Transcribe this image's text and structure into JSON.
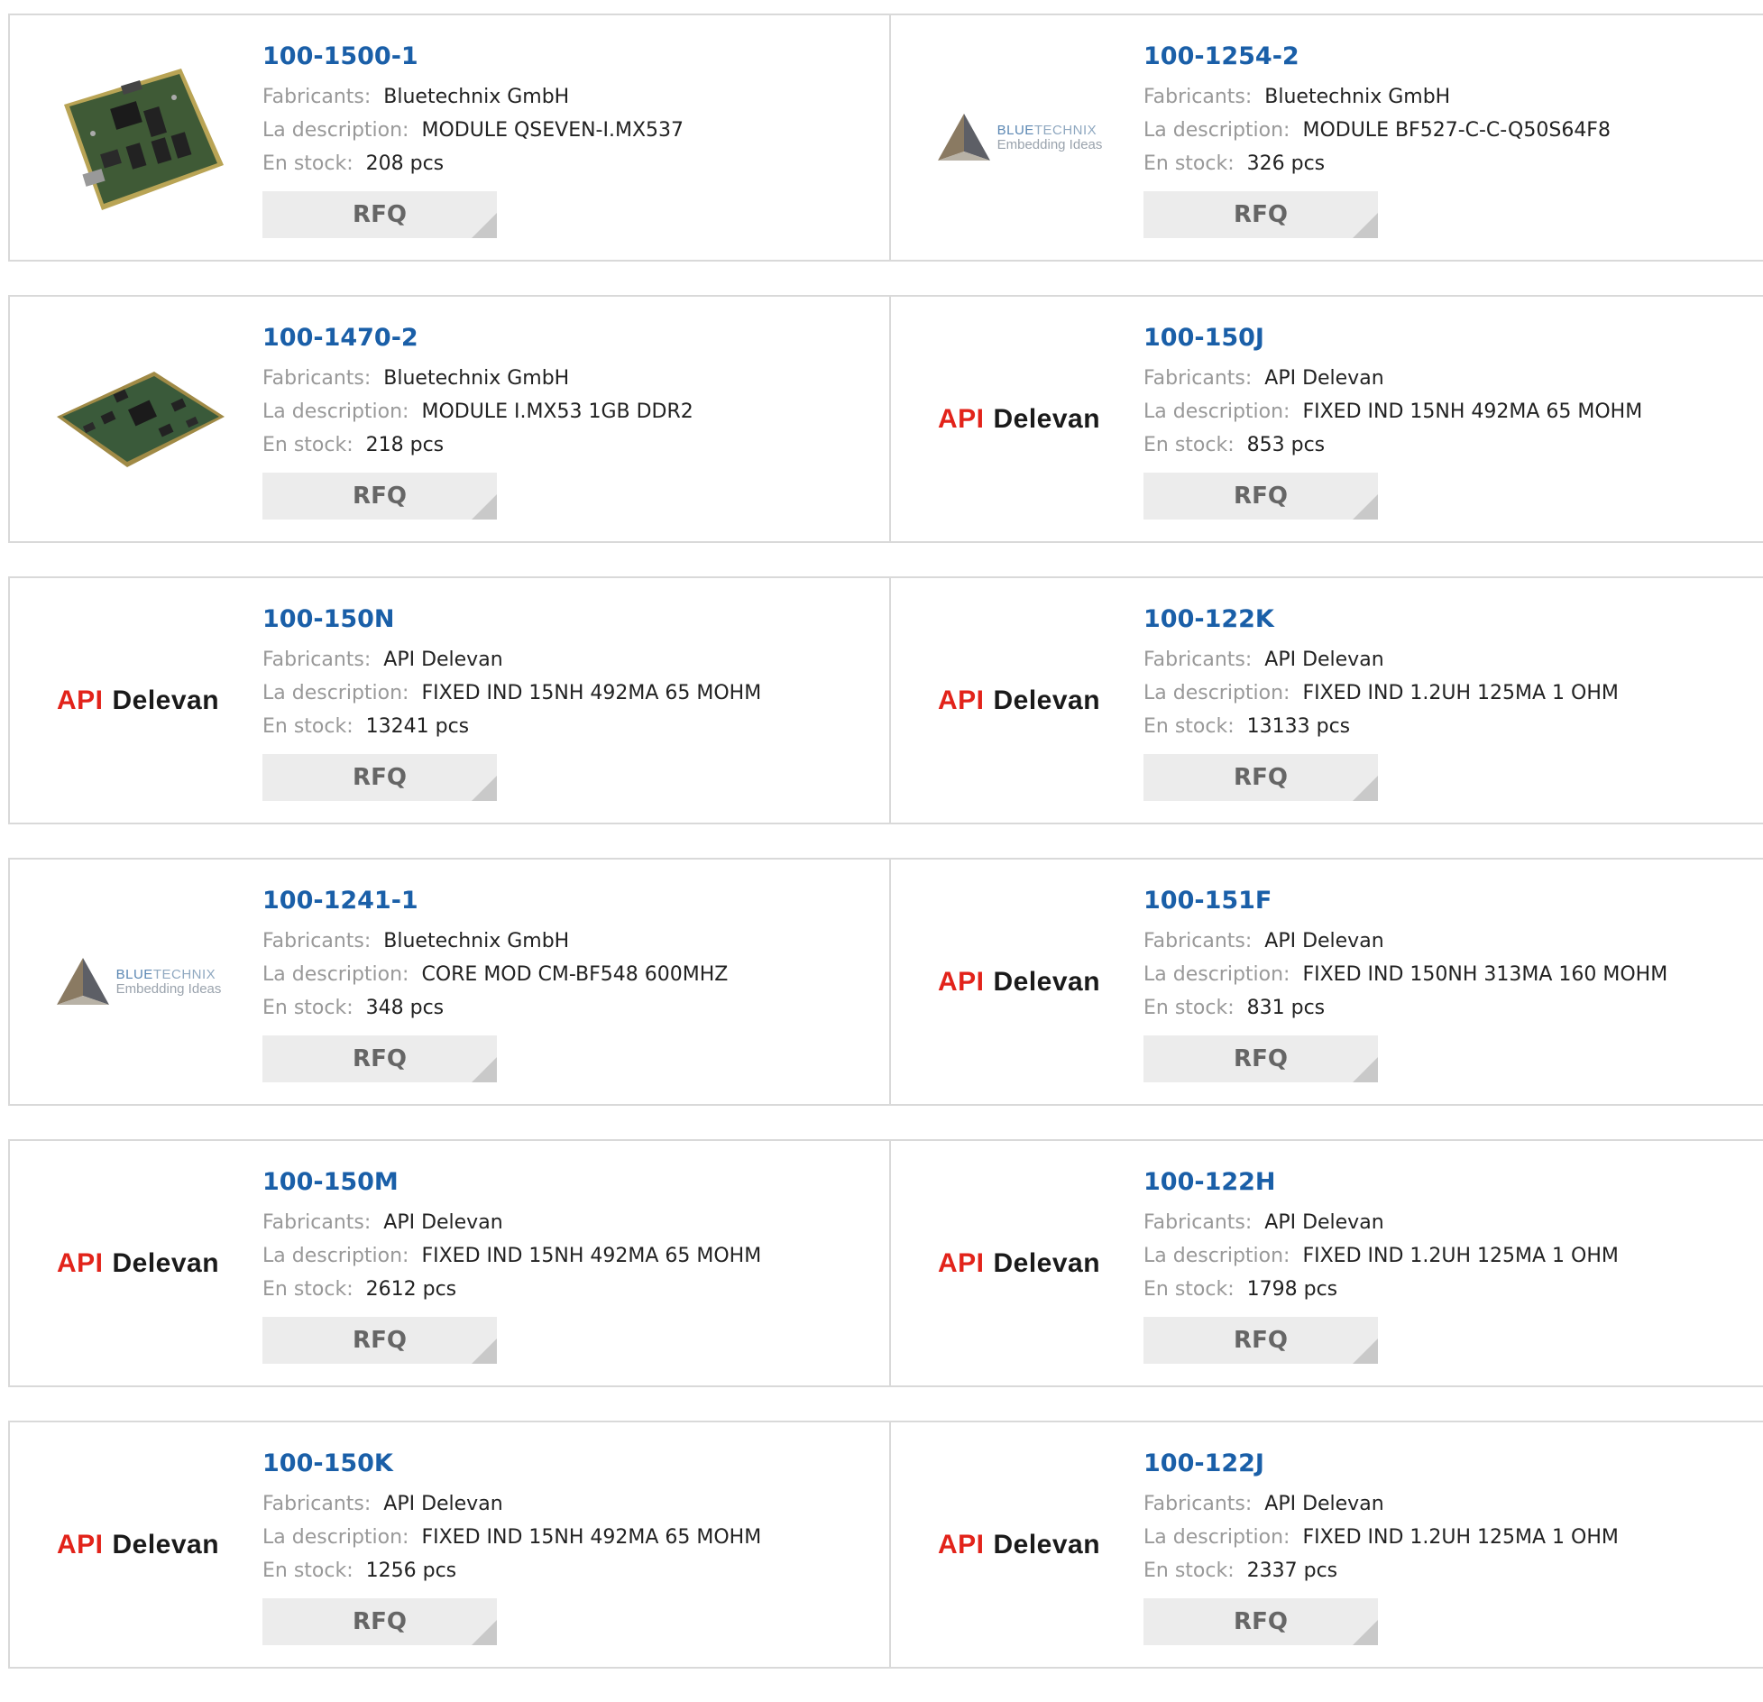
{
  "labels": {
    "manufacturer": "Fabricants:",
    "description": "La description:",
    "stock": "En stock:",
    "rfq": "RFQ"
  },
  "logos": {
    "api_delevan": {
      "part1": "API",
      "part2": "Delevan"
    },
    "bluetechnix": {
      "part1": "BLUE",
      "part2": "TECHNIX",
      "tagline": "Embedding Ideas"
    }
  },
  "colors": {
    "part_link": "#1a5fa8",
    "label_gray": "#999999",
    "api_red": "#e2231a",
    "rfq_bg": "#ececec"
  },
  "products": [
    {
      "part": "100-1500-1",
      "manufacturer": "Bluetechnix GmbH",
      "description": "MODULE QSEVEN-I.MX537",
      "stock": "208 pcs",
      "image": "board-photo"
    },
    {
      "part": "100-1254-2",
      "manufacturer": "Bluetechnix GmbH",
      "description": "MODULE BF527-C-C-Q50S64F8",
      "stock": "326 pcs",
      "image": "bluetechnix-logo"
    },
    {
      "part": "100-1470-2",
      "manufacturer": "Bluetechnix GmbH",
      "description": "MODULE I.MX53 1GB DDR2",
      "stock": "218 pcs",
      "image": "board-photo-2"
    },
    {
      "part": "100-150J",
      "manufacturer": "API Delevan",
      "description": "FIXED IND 15NH 492MA 65 MOHM",
      "stock": "853 pcs",
      "image": "api-delevan-logo"
    },
    {
      "part": "100-150N",
      "manufacturer": "API Delevan",
      "description": "FIXED IND 15NH 492MA 65 MOHM",
      "stock": "13241 pcs",
      "image": "api-delevan-logo"
    },
    {
      "part": "100-122K",
      "manufacturer": "API Delevan",
      "description": "FIXED IND 1.2UH 125MA 1 OHM",
      "stock": "13133 pcs",
      "image": "api-delevan-logo"
    },
    {
      "part": "100-1241-1",
      "manufacturer": "Bluetechnix GmbH",
      "description": "CORE MOD CM-BF548 600MHZ",
      "stock": "348 pcs",
      "image": "bluetechnix-logo"
    },
    {
      "part": "100-151F",
      "manufacturer": "API Delevan",
      "description": "FIXED IND 150NH 313MA 160 MOHM",
      "stock": "831 pcs",
      "image": "api-delevan-logo"
    },
    {
      "part": "100-150M",
      "manufacturer": "API Delevan",
      "description": "FIXED IND 15NH 492MA 65 MOHM",
      "stock": "2612 pcs",
      "image": "api-delevan-logo"
    },
    {
      "part": "100-122H",
      "manufacturer": "API Delevan",
      "description": "FIXED IND 1.2UH 125MA 1 OHM",
      "stock": "1798 pcs",
      "image": "api-delevan-logo"
    },
    {
      "part": "100-150K",
      "manufacturer": "API Delevan",
      "description": "FIXED IND 15NH 492MA 65 MOHM",
      "stock": "1256 pcs",
      "image": "api-delevan-logo"
    },
    {
      "part": "100-122J",
      "manufacturer": "API Delevan",
      "description": "FIXED IND 1.2UH 125MA 1 OHM",
      "stock": "2337 pcs",
      "image": "api-delevan-logo"
    }
  ]
}
